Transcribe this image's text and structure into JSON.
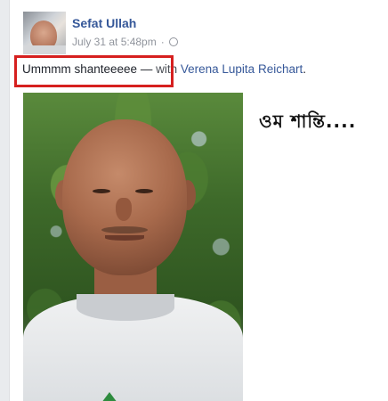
{
  "post": {
    "author": "Sefat Ullah",
    "timestamp": "July 31 at 5:48pm",
    "separator": "·",
    "privacy_icon": "globe-icon",
    "text": "Ummmm shanteeeee",
    "dash": "—",
    "with_prefix": "with",
    "tagged_user": "Verena Lupita Reichart",
    "trailing": "."
  },
  "overlay": {
    "caption": "ওম শান্তি...."
  },
  "colors": {
    "link": "#365899",
    "highlight_border": "#d6201f",
    "meta": "#90949c"
  }
}
